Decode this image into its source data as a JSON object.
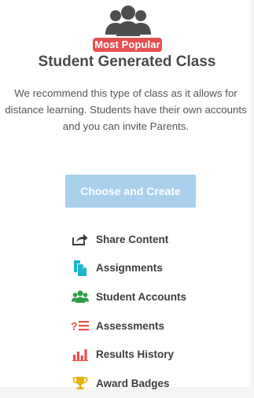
{
  "class_card": {
    "badge": "Most Popular",
    "title": "Student Generated Class",
    "description": "We recommend this type of class as it allows for distance learning. Students have their own accounts and you can invite Parents.",
    "button_label": "Choose and Create",
    "features": [
      {
        "label": "Share Content",
        "icon": "share-icon"
      },
      {
        "label": "Assignments",
        "icon": "assignments-icon"
      },
      {
        "label": "Student Accounts",
        "icon": "students-icon"
      },
      {
        "label": "Assessments",
        "icon": "assessments-icon"
      },
      {
        "label": "Results History",
        "icon": "results-chart-icon"
      },
      {
        "label": "Award Badges",
        "icon": "trophy-icon"
      }
    ]
  },
  "colors": {
    "badge": "#e64f52",
    "button": "#a9d1ee",
    "share": "#3a3a3a",
    "assignments": "#1bb5c9",
    "students": "#2e9e45",
    "assessments": "#e6533a",
    "results": "#e64f52",
    "trophy": "#e8b000"
  }
}
